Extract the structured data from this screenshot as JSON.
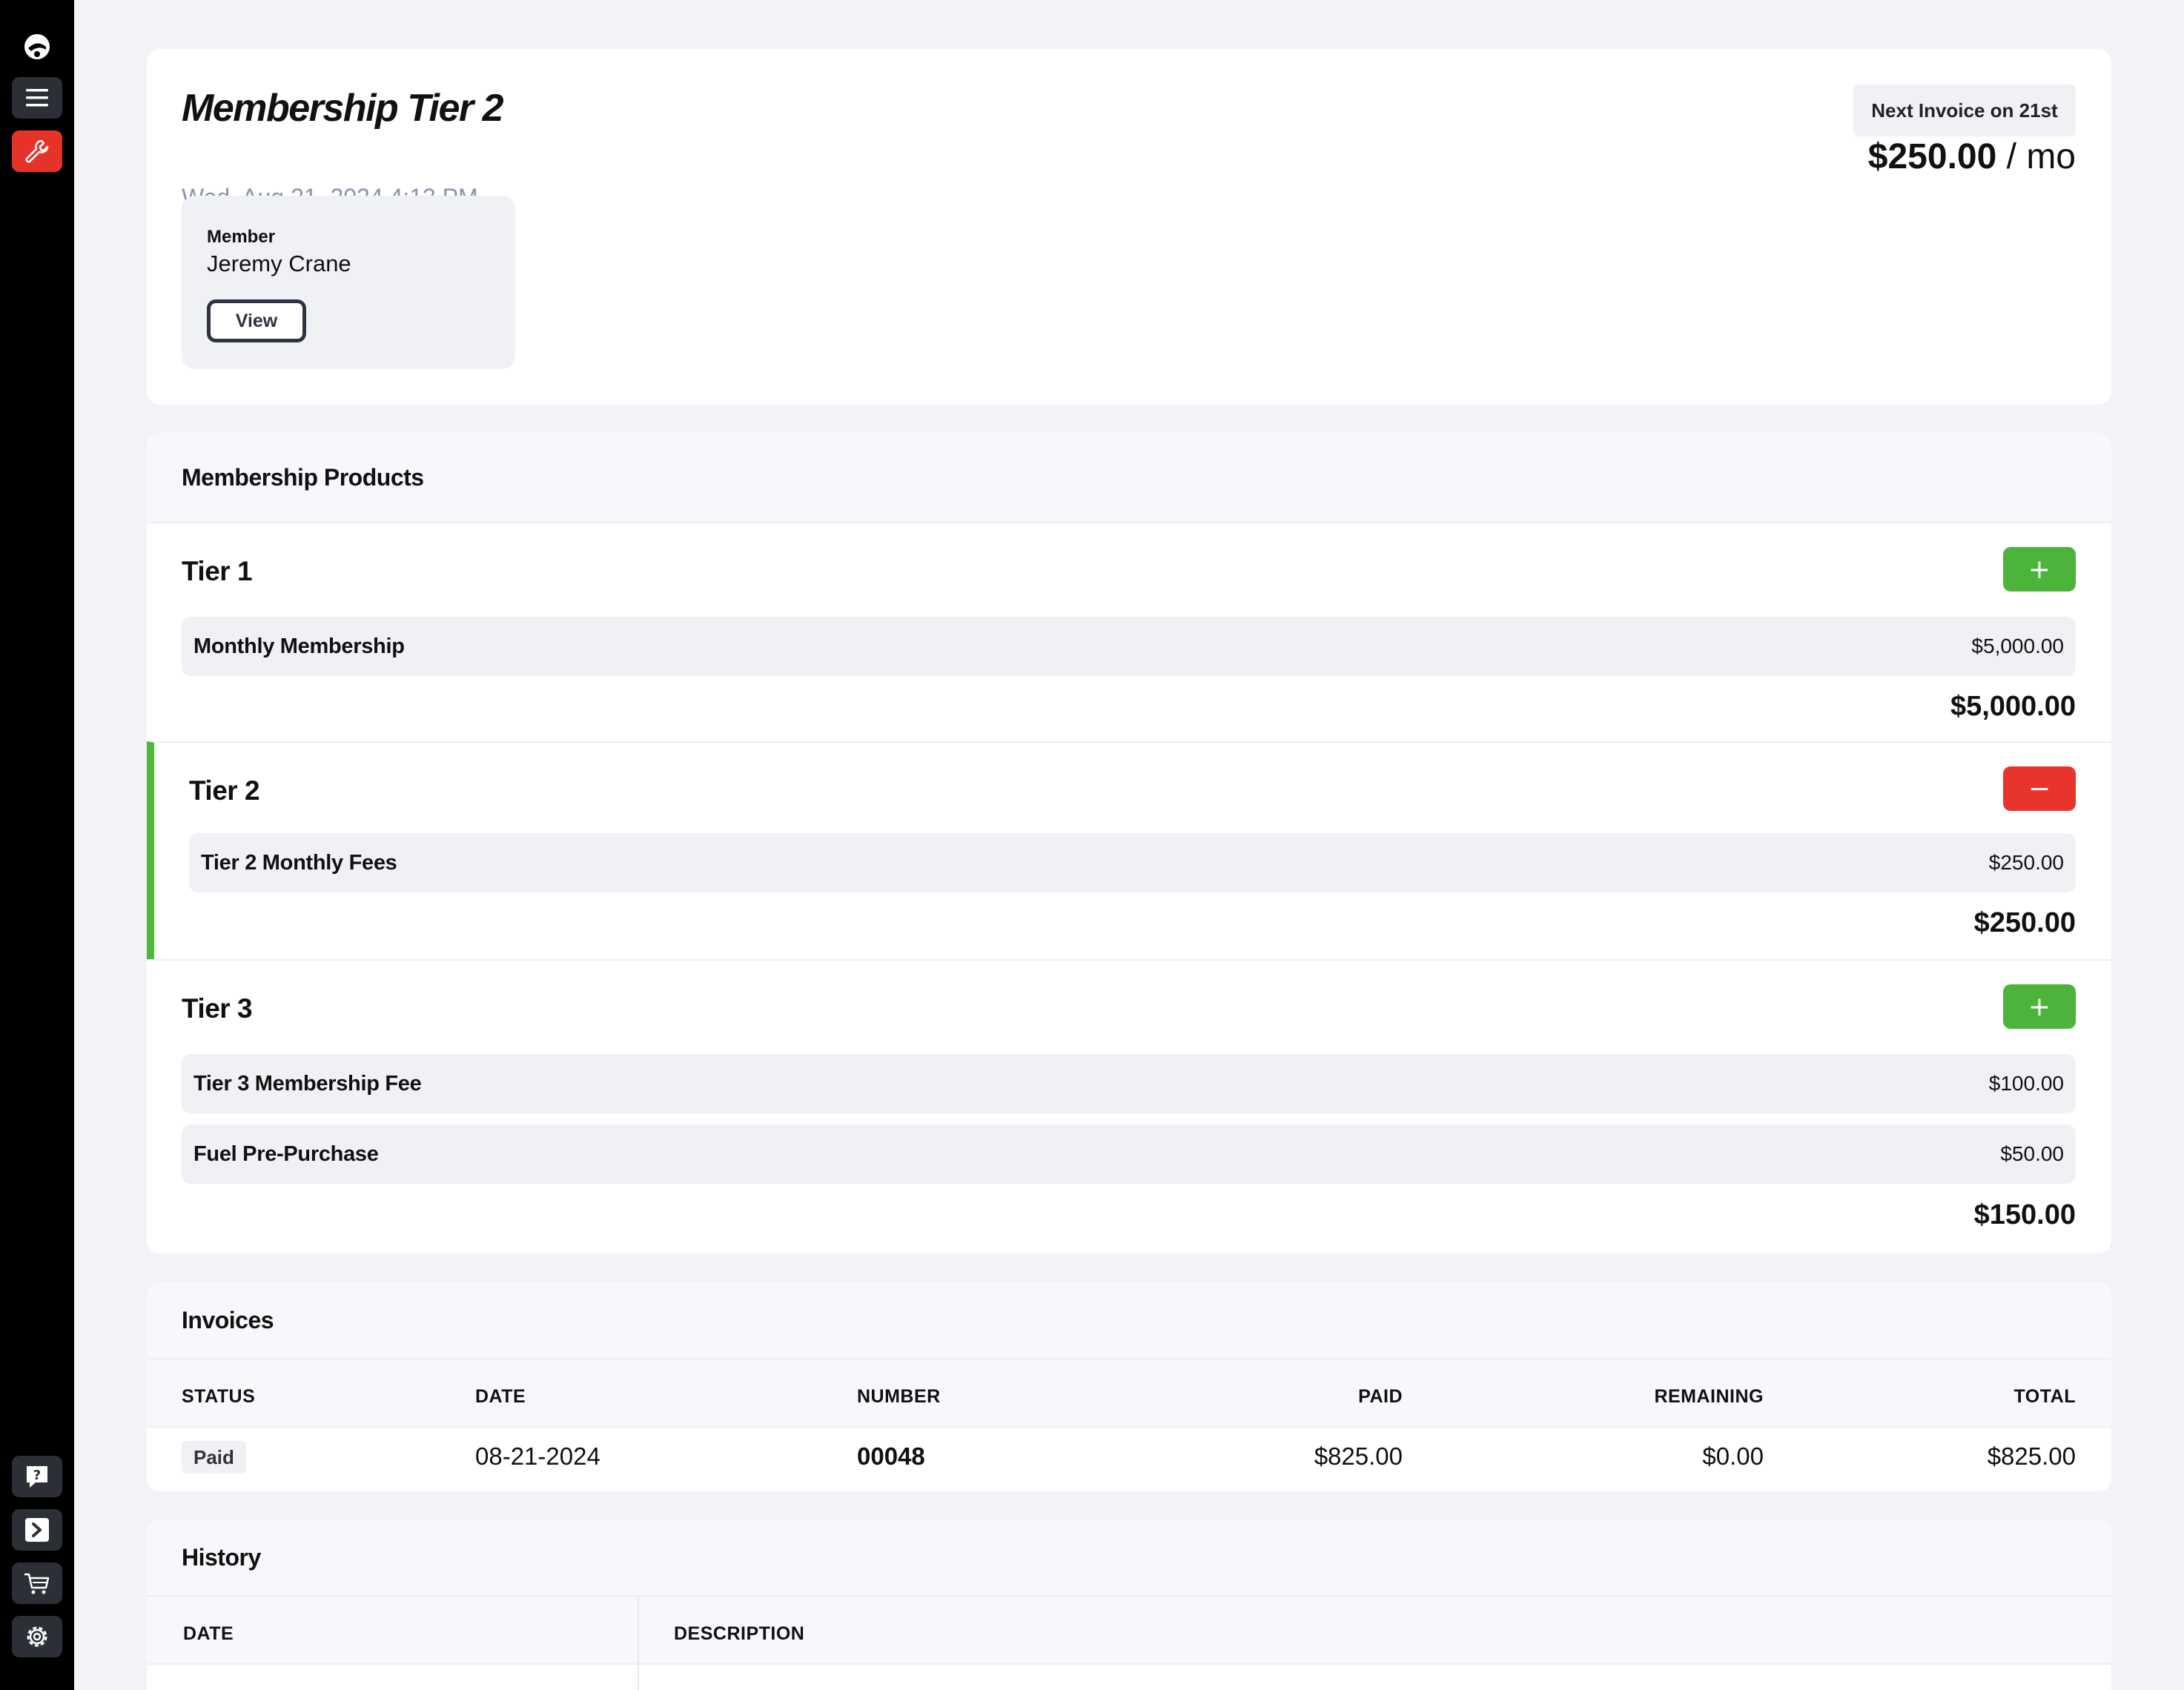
{
  "sidebar": {
    "top_icons": [
      "logo-icon",
      "menu-icon",
      "wrench-icon"
    ],
    "bottom_icons": [
      "help-icon",
      "terminal-icon",
      "cart-icon",
      "gear-icon"
    ],
    "accent_color": "#e5332a"
  },
  "header": {
    "title": "Membership Tier 2",
    "date": "Wed, Aug 21, 2024 4:13 PM",
    "member_label": "Member",
    "member_name": "Jeremy Crane",
    "view_button": "View",
    "next_invoice": "Next Invoice on 21st",
    "price_amount": "$250.00",
    "price_period": "/ mo"
  },
  "products": {
    "heading": "Membership Products",
    "tiers": [
      {
        "name": "Tier 1",
        "action": "+",
        "items": [
          {
            "name": "Monthly Membership",
            "price": "$5,000.00"
          }
        ],
        "subtotal": "$5,000.00"
      },
      {
        "name": "Tier 2",
        "action": "−",
        "active": true,
        "items": [
          {
            "name": "Tier 2 Monthly Fees",
            "price": "$250.00"
          }
        ],
        "subtotal": "$250.00"
      },
      {
        "name": "Tier 3",
        "action": "+",
        "items": [
          {
            "name": "Tier 3 Membership Fee",
            "price": "$100.00"
          },
          {
            "name": "Fuel Pre-Purchase",
            "price": "$50.00"
          }
        ],
        "subtotal": "$150.00"
      }
    ],
    "add_color": "#4cb43a",
    "remove_color": "#e8342a"
  },
  "invoices": {
    "heading": "Invoices",
    "columns": [
      "STATUS",
      "DATE",
      "NUMBER",
      "PAID",
      "REMAINING",
      "TOTAL"
    ],
    "rows": [
      {
        "status": "Paid",
        "date": "08-21-2024",
        "number": "00048",
        "paid": "$825.00",
        "remaining": "$0.00",
        "total": "$825.00"
      }
    ]
  },
  "history": {
    "heading": "History",
    "columns": [
      "DATE",
      "DESCRIPTION"
    ]
  }
}
